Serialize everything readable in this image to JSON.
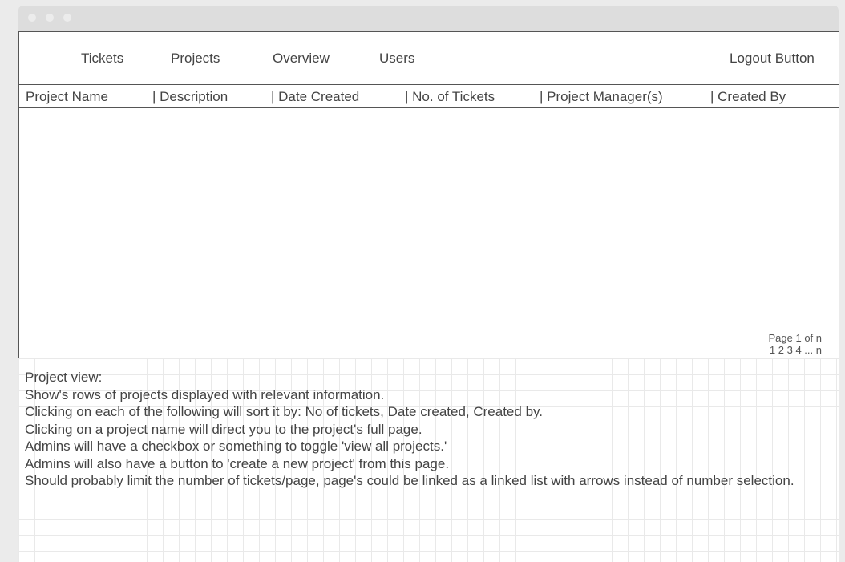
{
  "nav": {
    "tickets": "Tickets",
    "projects": "Projects",
    "overview": "Overview",
    "users": "Users",
    "logout": "Logout Button"
  },
  "table": {
    "columns": [
      "Project Name",
      "| Description",
      "| Date Created",
      "| No. of Tickets",
      "| Project Manager(s)",
      "| Created By"
    ],
    "rows": []
  },
  "pagination": {
    "page_label": "Page 1 of n",
    "links": [
      "1",
      "2",
      "3",
      "4",
      "...",
      "n"
    ]
  },
  "notes": [
    "Project view:",
    "Show's rows of projects displayed with relevant information.",
    "Clicking on each of the following will sort it by: No of tickets, Date created, Created by.",
    "Clicking on a project name will direct you to the project's full page.",
    "Admins will have a checkbox or something to toggle 'view all projects.'",
    "Admins will also have a button to 'create a new project' from this page.",
    "Should probably limit the number of tickets/page, page's could be linked as a linked list with arrows instead of number selection."
  ]
}
